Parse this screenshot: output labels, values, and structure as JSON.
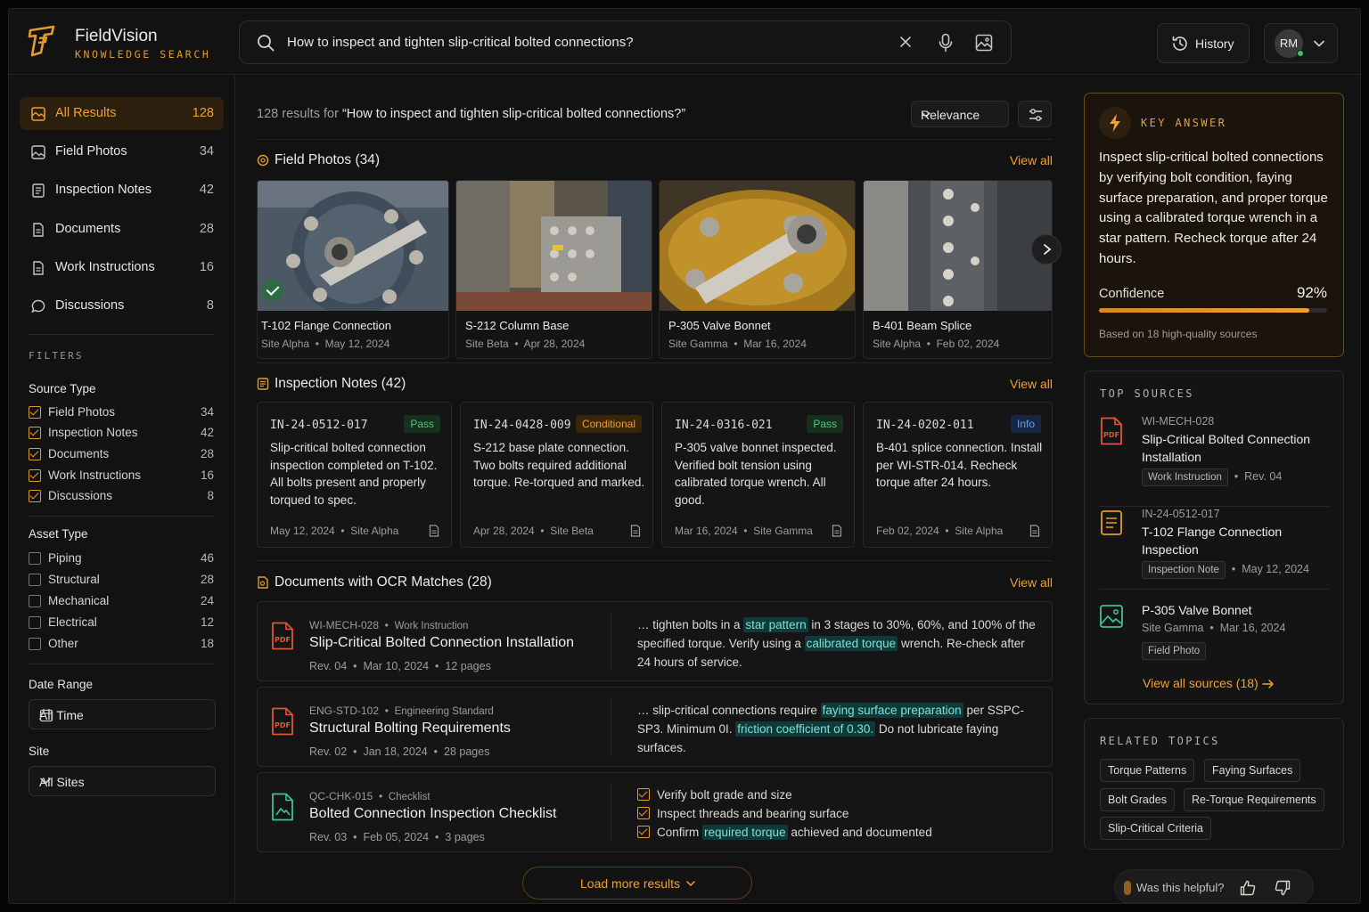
{
  "app": {
    "name": "FieldVision",
    "subtitle": "KNOWLEDGE SEARCH",
    "accent": "#f0a030"
  },
  "search": {
    "query": "How to inspect and tighten slip-critical bolted connections?"
  },
  "header": {
    "history_label": "History",
    "user_initials": "RM"
  },
  "sidebar": {
    "nav": [
      {
        "label": "All Results",
        "count": "128",
        "icon": "grid-icon",
        "active": true
      },
      {
        "label": "Field Photos",
        "count": "34",
        "icon": "image-icon"
      },
      {
        "label": "Inspection Notes",
        "count": "42",
        "icon": "note-icon"
      },
      {
        "label": "Documents",
        "count": "28",
        "icon": "document-icon"
      },
      {
        "label": "Work Instructions",
        "count": "16",
        "icon": "document-icon"
      },
      {
        "label": "Discussions",
        "count": "8",
        "icon": "chat-icon"
      }
    ],
    "filters_label": "FILTERS",
    "source_type": {
      "title": "Source Type",
      "items": [
        {
          "label": "Field Photos",
          "count": "34",
          "checked": true
        },
        {
          "label": "Inspection Notes",
          "count": "42",
          "checked": true
        },
        {
          "label": "Documents",
          "count": "28",
          "checked": true
        },
        {
          "label": "Work Instructions",
          "count": "16",
          "checked": true
        },
        {
          "label": "Discussions",
          "count": "8",
          "checked": true
        }
      ]
    },
    "asset_type": {
      "title": "Asset Type",
      "items": [
        {
          "label": "Piping",
          "count": "46",
          "checked": false
        },
        {
          "label": "Structural",
          "count": "28",
          "checked": false
        },
        {
          "label": "Mechanical",
          "count": "24",
          "checked": false
        },
        {
          "label": "Electrical",
          "count": "12",
          "checked": false
        },
        {
          "label": "Other",
          "count": "18",
          "checked": false
        }
      ]
    },
    "date_range": {
      "title": "Date Range",
      "value": "All Time"
    },
    "site": {
      "title": "Site",
      "value": "All Sites"
    }
  },
  "results": {
    "count": "128",
    "prefix": "results for",
    "query_quoted": "“How to inspect and tighten slip-critical bolted connections?”",
    "sort": "Relevance"
  },
  "sections": {
    "photos": {
      "title": "Field Photos (34)",
      "view_all": "View all"
    },
    "notes": {
      "title": "Inspection Notes (42)",
      "view_all": "View all"
    },
    "docs": {
      "title": "Documents with OCR Matches (28)",
      "view_all": "View all"
    }
  },
  "photos": [
    {
      "title": "T-102 Flange Connection",
      "site": "Site Alpha",
      "date": "May 12, 2024",
      "verified": true
    },
    {
      "title": "S-212 Column Base",
      "site": "Site Beta",
      "date": "Apr 28, 2024"
    },
    {
      "title": "P-305 Valve Bonnet",
      "site": "Site Gamma",
      "date": "Mar 16, 2024"
    },
    {
      "title": "B-401 Beam Splice",
      "site": "Site Alpha",
      "date": "Feb 02, 2024"
    }
  ],
  "notes": [
    {
      "id": "IN-24-0512-017",
      "badge": "Pass",
      "body": "Slip-critical bolted connection inspection completed on T-102. All bolts present and properly torqued to spec.",
      "date": "May 12, 2024",
      "site": "Site Alpha"
    },
    {
      "id": "IN-24-0428-009",
      "badge": "Conditional",
      "body": "S-212 base plate connection. Two bolts required additional torque. Re-torqued and marked.",
      "date": "Apr 28, 2024",
      "site": "Site Beta"
    },
    {
      "id": "IN-24-0316-021",
      "badge": "Pass",
      "body": "P-305 valve bonnet inspected. Verified bolt tension using calibrated torque wrench. All good.",
      "date": "Mar 16, 2024",
      "site": "Site Gamma"
    },
    {
      "id": "IN-24-0202-011",
      "badge": "Info",
      "body": "B-401 splice connection. Install per WI-STR-014. Recheck torque after 24 hours.",
      "date": "Feb 02, 2024",
      "site": "Site Alpha"
    }
  ],
  "docs": [
    {
      "code": "WI-MECH-028",
      "type": "Work Instruction",
      "title": "Slip-Critical Bolted Connection Installation",
      "rev": "Rev. 04",
      "date": "Mar 10, 2024",
      "pages": "12 pages",
      "s1": "… tighten bolts in a ",
      "h1": "star pattern",
      "s2": " in 3 stages to 30%, 60%, and 100% of the specified torque. Verify using a ",
      "h2": "calibrated torque",
      "s3": " wrench. Re-check after 24 hours of service."
    },
    {
      "code": "ENG-STD-102",
      "type": "Engineering Standard",
      "title": "Structural Bolting Requirements",
      "rev": "Rev. 02",
      "date": "Jan 18, 2024",
      "pages": "28 pages",
      "s1": "… slip-critical connections require ",
      "h1": "faying surface preparation",
      "s2": " per SSPC-SP3. Minimum 0I. ",
      "h2": "friction coefficient of 0.30.",
      "s3": " Do not lubricate faying surfaces."
    },
    {
      "code": "QC-CHK-015",
      "type": "Checklist",
      "title": "Bolted Connection Inspection Checklist",
      "rev": "Rev. 03",
      "date": "Feb 05, 2024",
      "pages": "3 pages",
      "c1": "Verify bolt grade and size",
      "c2": "Inspect threads and bearing surface",
      "c3a": "Confirm ",
      "c3h": "required torque",
      "c3b": " achieved and documented"
    }
  ],
  "load_more": "Load more results",
  "key_answer": {
    "label": "KEY ANSWER",
    "text": "Inspect slip-critical bolted connections by verifying bolt condition, faying surface preparation, and proper torque using a calibrated torque wrench in a star pattern. Recheck torque after 24 hours.",
    "confidence_label": "Confidence",
    "confidence_value": "92%",
    "confidence": 0.92,
    "based_on": "Based on 18 high-quality sources"
  },
  "top_sources": {
    "label": "TOP SOURCES",
    "items": [
      {
        "id": "WI-MECH-028",
        "title": "Slip-Critical Bolted Connection Installation",
        "tag": "Work Instruction",
        "meta": "Rev. 04",
        "icon": "pdf-icon"
      },
      {
        "id": "IN-24-0512-017",
        "title": "T-102 Flange Connection Inspection",
        "tag": "Inspection Note",
        "meta": "May 12, 2024",
        "icon": "note-icon"
      },
      {
        "title": "P-305 Valve Bonnet",
        "site": "Site Gamma",
        "date": "Mar 16, 2024",
        "tag": "Field Photo",
        "icon": "image-icon"
      }
    ],
    "view_all": "View all sources (18)"
  },
  "related": {
    "label": "RELATED TOPICS",
    "chips": [
      "Torque Patterns",
      "Faying Surfaces",
      "Bolt Grades",
      "Re-Torque Requirements",
      "Slip-Critical Criteria"
    ]
  },
  "feedback": {
    "label": "Was this helpful?"
  }
}
